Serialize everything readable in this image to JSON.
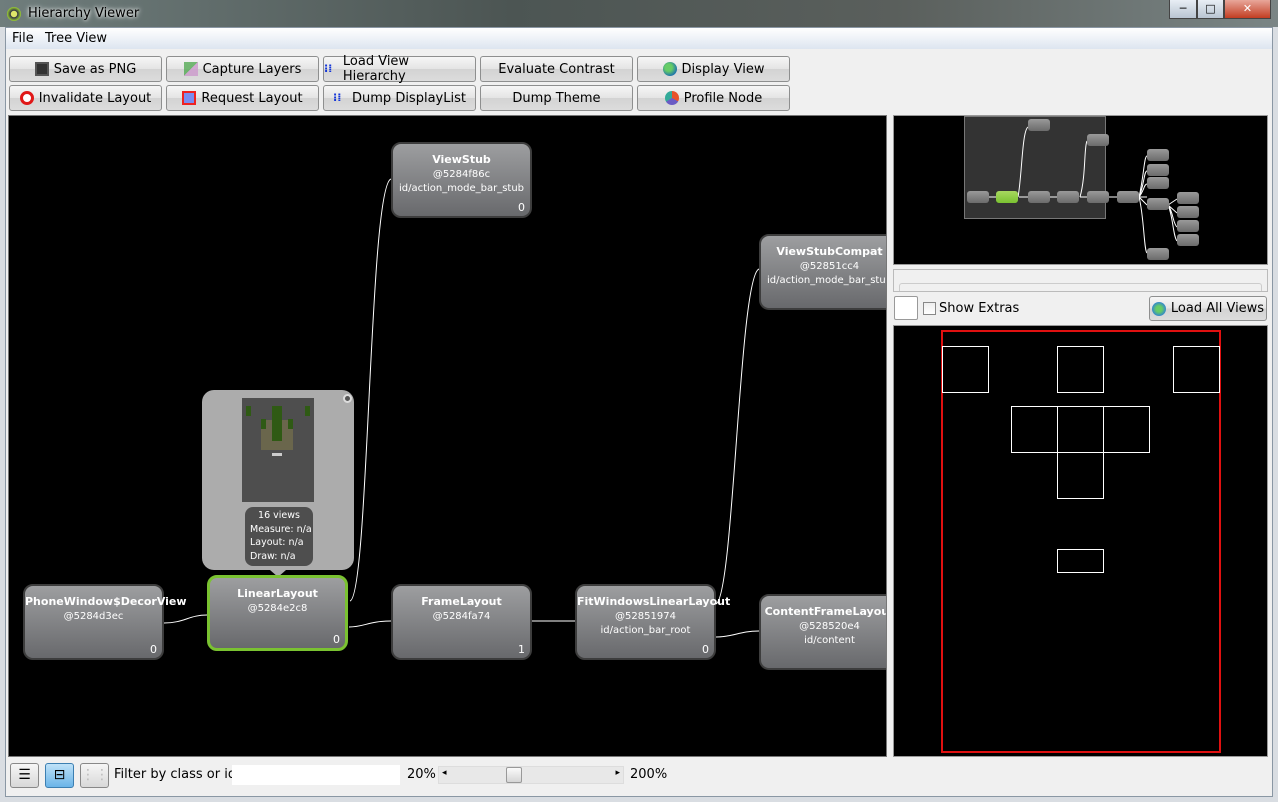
{
  "window": {
    "title": "Hierarchy Viewer",
    "controls": [
      "─",
      "□",
      "✕"
    ]
  },
  "menu": [
    {
      "label": "File"
    },
    {
      "label": "Tree View"
    }
  ],
  "toolbar": [
    {
      "label": "Save as PNG",
      "icon": "floppy-icon"
    },
    {
      "label": "Capture Layers",
      "icon": "layers-icon"
    },
    {
      "label": "Load View Hierarchy",
      "icon": "hierarchy-icon"
    },
    {
      "label": "Evaluate Contrast",
      "icon": ""
    },
    {
      "label": "Display View",
      "icon": "globe-icon"
    },
    {
      "label": "Invalidate Layout",
      "icon": "no-entry-icon"
    },
    {
      "label": "Request Layout",
      "icon": "request-layout-icon"
    },
    {
      "label": "Dump DisplayList",
      "icon": "hierarchy-icon"
    },
    {
      "label": "Dump Theme",
      "icon": ""
    },
    {
      "label": "Profile Node",
      "icon": "profile-icon"
    }
  ],
  "tree": {
    "nodes": [
      {
        "name": "ViewStub",
        "hash": "@5284f86c",
        "id": "id/action_mode_bar_stub",
        "index": "0"
      },
      {
        "name": "ViewStubCompat",
        "hash": "@52851cc4",
        "id": "id/action_mode_bar_stub",
        "index": ""
      },
      {
        "name": "PhoneWindow$DecorView",
        "hash": "@5284d3ec",
        "id": "",
        "index": "0"
      },
      {
        "name": "LinearLayout",
        "hash": "@5284e2c8",
        "id": "",
        "index": "0",
        "selected": true
      },
      {
        "name": "FrameLayout",
        "hash": "@5284fa74",
        "id": "",
        "index": "1"
      },
      {
        "name": "FitWindowsLinearLayout",
        "hash": "@52851974",
        "id": "id/action_bar_root",
        "index": "0"
      },
      {
        "name": "ContentFrameLayout",
        "hash": "@528520e4",
        "id": "id/content",
        "index": ""
      }
    ],
    "popup": {
      "views": "16 views",
      "measure": "Measure: n/a",
      "layout": "Layout: n/a",
      "draw": "Draw: n/a"
    },
    "selected_color": "#7ac231"
  },
  "side": {
    "show_extras_label": "Show Extras",
    "show_extras_checked": false,
    "load_all_label": "Load All Views"
  },
  "bottom": {
    "filter_label": "Filter by class or id:",
    "filter_value": "",
    "zoom_min": "20%",
    "zoom_max": "200%",
    "zoom_slider_fraction": 0.38
  }
}
